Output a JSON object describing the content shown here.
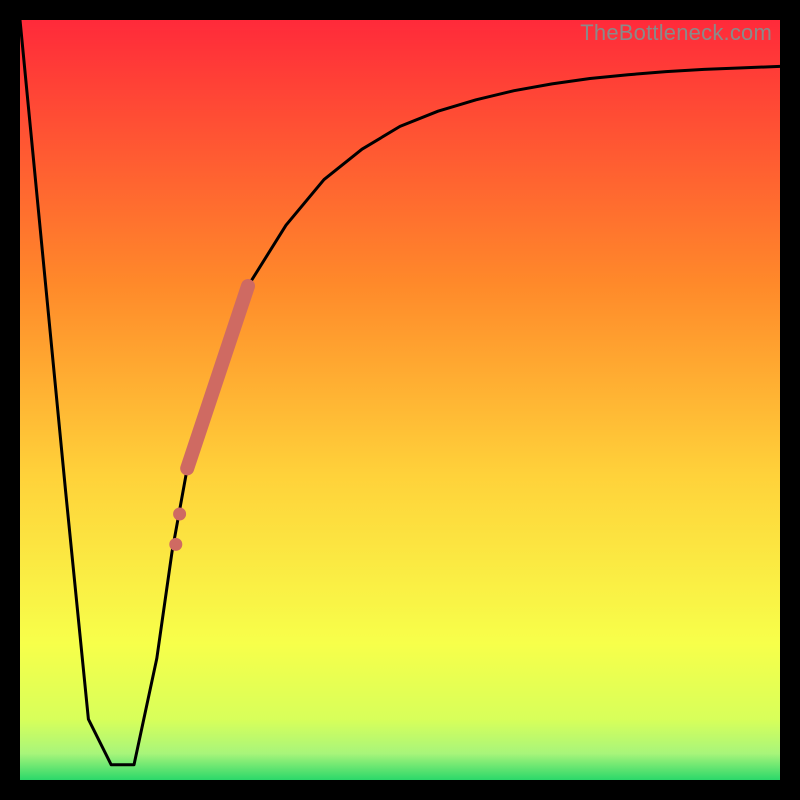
{
  "watermark": "TheBottleneck.com",
  "colors": {
    "top": "#ff2a3a",
    "mid_upper": "#ff8a2a",
    "mid": "#ffd23a",
    "mid_lower": "#f7ff4a",
    "lower": "#d8ff5a",
    "bottom": "#2bd86a",
    "curve_stroke": "#000000",
    "marker_fill": "#cf6a62"
  },
  "chart_data": {
    "type": "line",
    "title": "",
    "xlabel": "",
    "ylabel": "",
    "xlim": [
      0,
      100
    ],
    "ylim": [
      0,
      100
    ],
    "series": [
      {
        "name": "bottleneck-curve",
        "x": [
          0,
          3,
          6,
          9,
          12,
          15,
          18,
          20,
          22,
          25,
          28,
          30,
          35,
          40,
          45,
          50,
          55,
          60,
          65,
          70,
          75,
          80,
          85,
          90,
          95,
          100
        ],
        "y": [
          100,
          69,
          38,
          8,
          2,
          2,
          16,
          30,
          41,
          52,
          60,
          65,
          73,
          79,
          83,
          86,
          88,
          89.5,
          90.7,
          91.6,
          92.3,
          92.8,
          93.2,
          93.5,
          93.7,
          93.9
        ]
      },
      {
        "name": "highlight-band",
        "x": [
          22,
          30
        ],
        "y": [
          41,
          65
        ]
      },
      {
        "name": "highlight-dots",
        "x": [
          20.5,
          21,
          22
        ],
        "y": [
          31,
          35,
          41
        ]
      }
    ],
    "gradient_stops": [
      {
        "offset": 0.0,
        "color": "#ff2a3a"
      },
      {
        "offset": 0.35,
        "color": "#ff8a2a"
      },
      {
        "offset": 0.6,
        "color": "#ffd23a"
      },
      {
        "offset": 0.82,
        "color": "#f7ff4a"
      },
      {
        "offset": 0.92,
        "color": "#d8ff5a"
      },
      {
        "offset": 0.965,
        "color": "#a8f57a"
      },
      {
        "offset": 1.0,
        "color": "#2bd86a"
      }
    ]
  }
}
